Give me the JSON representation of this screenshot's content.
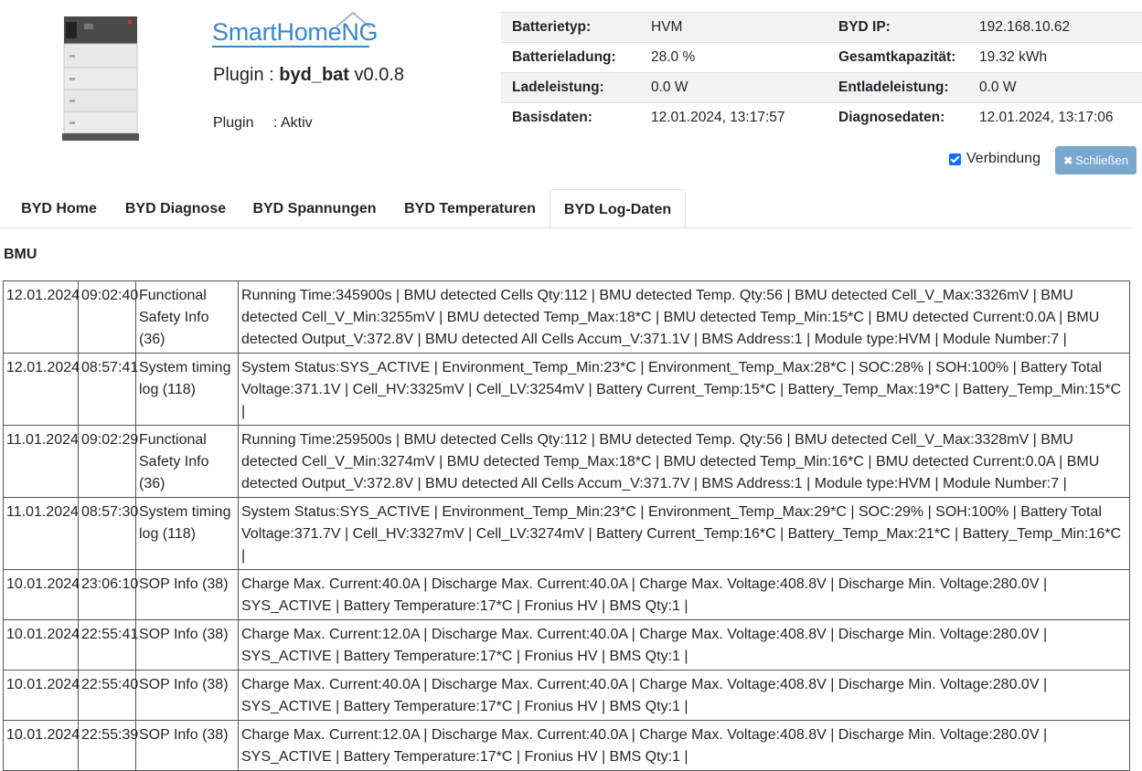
{
  "header": {
    "logo_text_main": "SmartHome",
    "logo_text_ng": "NG",
    "plugin_prefix": "Plugin : ",
    "plugin_name": "byd_bat",
    "plugin_version": " v0.0.8",
    "plugin_label": "Plugin",
    "plugin_status": ": Aktiv"
  },
  "info": {
    "rows": [
      {
        "l1": "Batterietyp:",
        "v1": "HVM",
        "l2": "BYD IP:",
        "v2": "192.168.10.62"
      },
      {
        "l1": "Batterieladung:",
        "v1": "28.0 %",
        "l2": "Gesamtkapazität:",
        "v2": "19.32 kWh"
      },
      {
        "l1": "Ladeleistung:",
        "v1": "0.0 W",
        "l2": "Entladeleistung:",
        "v2": "0.0 W"
      },
      {
        "l1": "Basisdaten:",
        "v1": "12.01.2024, 13:17:57",
        "l2": "Diagnosedaten:",
        "v2": "12.01.2024, 13:17:06"
      }
    ]
  },
  "controls": {
    "connection_label": "Verbindung",
    "connection_checked": true,
    "close_label": "Schließen"
  },
  "tabs": [
    {
      "label": "BYD Home",
      "active": false
    },
    {
      "label": "BYD Diagnose",
      "active": false
    },
    {
      "label": "BYD Spannungen",
      "active": false
    },
    {
      "label": "BYD Temperaturen",
      "active": false
    },
    {
      "label": "BYD Log-Daten",
      "active": true
    }
  ],
  "section_title": "BMU",
  "log_rows": [
    {
      "date": "12.01.2024",
      "time": "09:02:40",
      "type": "Functional Safety Info (36)",
      "text": "Running Time:345900s | BMU detected Cells Qty:112 | BMU detected Temp. Qty:56 | BMU detected Cell_V_Max:3326mV | BMU detected Cell_V_Min:3255mV | BMU detected Temp_Max:18*C | BMU detected Temp_Min:15*C | BMU detected Current:0.0A | BMU detected Output_V:372.8V | BMU detected All Cells Accum_V:371.1V | BMS Address:1 | Module type:HVM | Module Number:7 |"
    },
    {
      "date": "12.01.2024",
      "time": "08:57:41",
      "type": "System timing log (118)",
      "text": "System Status:SYS_ACTIVE | Environment_Temp_Min:23*C | Environment_Temp_Max:28*C | SOC:28% | SOH:100% | Battery Total Voltage:371.1V | Cell_HV:3325mV | Cell_LV:3254mV | Battery Current_Temp:15*C | Battery_Temp_Max:19*C | Battery_Temp_Min:15*C |"
    },
    {
      "date": "11.01.2024",
      "time": "09:02:29",
      "type": "Functional Safety Info (36)",
      "text": "Running Time:259500s | BMU detected Cells Qty:112 | BMU detected Temp. Qty:56 | BMU detected Cell_V_Max:3328mV | BMU detected Cell_V_Min:3274mV | BMU detected Temp_Max:18*C | BMU detected Temp_Min:16*C | BMU detected Current:0.0A | BMU detected Output_V:372.8V | BMU detected All Cells Accum_V:371.7V | BMS Address:1 | Module type:HVM | Module Number:7 |"
    },
    {
      "date": "11.01.2024",
      "time": "08:57:30",
      "type": "System timing log (118)",
      "text": "System Status:SYS_ACTIVE | Environment_Temp_Min:23*C | Environment_Temp_Max:29*C | SOC:29% | SOH:100% | Battery Total Voltage:371.7V | Cell_HV:3327mV | Cell_LV:3274mV | Battery Current_Temp:16*C | Battery_Temp_Max:21*C | Battery_Temp_Min:16*C |"
    },
    {
      "date": "10.01.2024",
      "time": "23:06:10",
      "type": "SOP Info (38)",
      "text": "Charge Max. Current:40.0A | Discharge Max. Current:40.0A | Charge Max. Voltage:408.8V | Discharge Min. Voltage:280.0V | SYS_ACTIVE | Battery Temperature:17*C | Fronius HV | BMS Qty:1 |"
    },
    {
      "date": "10.01.2024",
      "time": "22:55:41",
      "type": "SOP Info (38)",
      "text": "Charge Max. Current:12.0A | Discharge Max. Current:40.0A | Charge Max. Voltage:408.8V | Discharge Min. Voltage:280.0V | SYS_ACTIVE | Battery Temperature:17*C | Fronius HV | BMS Qty:1 |"
    },
    {
      "date": "10.01.2024",
      "time": "22:55:40",
      "type": "SOP Info (38)",
      "text": "Charge Max. Current:40.0A | Discharge Max. Current:40.0A | Charge Max. Voltage:408.8V | Discharge Min. Voltage:280.0V | SYS_ACTIVE | Battery Temperature:17*C | Fronius HV | BMS Qty:1 |"
    },
    {
      "date": "10.01.2024",
      "time": "22:55:39",
      "type": "SOP Info (38)",
      "text": "Charge Max. Current:12.0A | Discharge Max. Current:40.0A | Charge Max. Voltage:408.8V | Discharge Min. Voltage:280.0V | SYS_ACTIVE | Battery Temperature:17*C | Fronius HV | BMS Qty:1 |"
    }
  ]
}
